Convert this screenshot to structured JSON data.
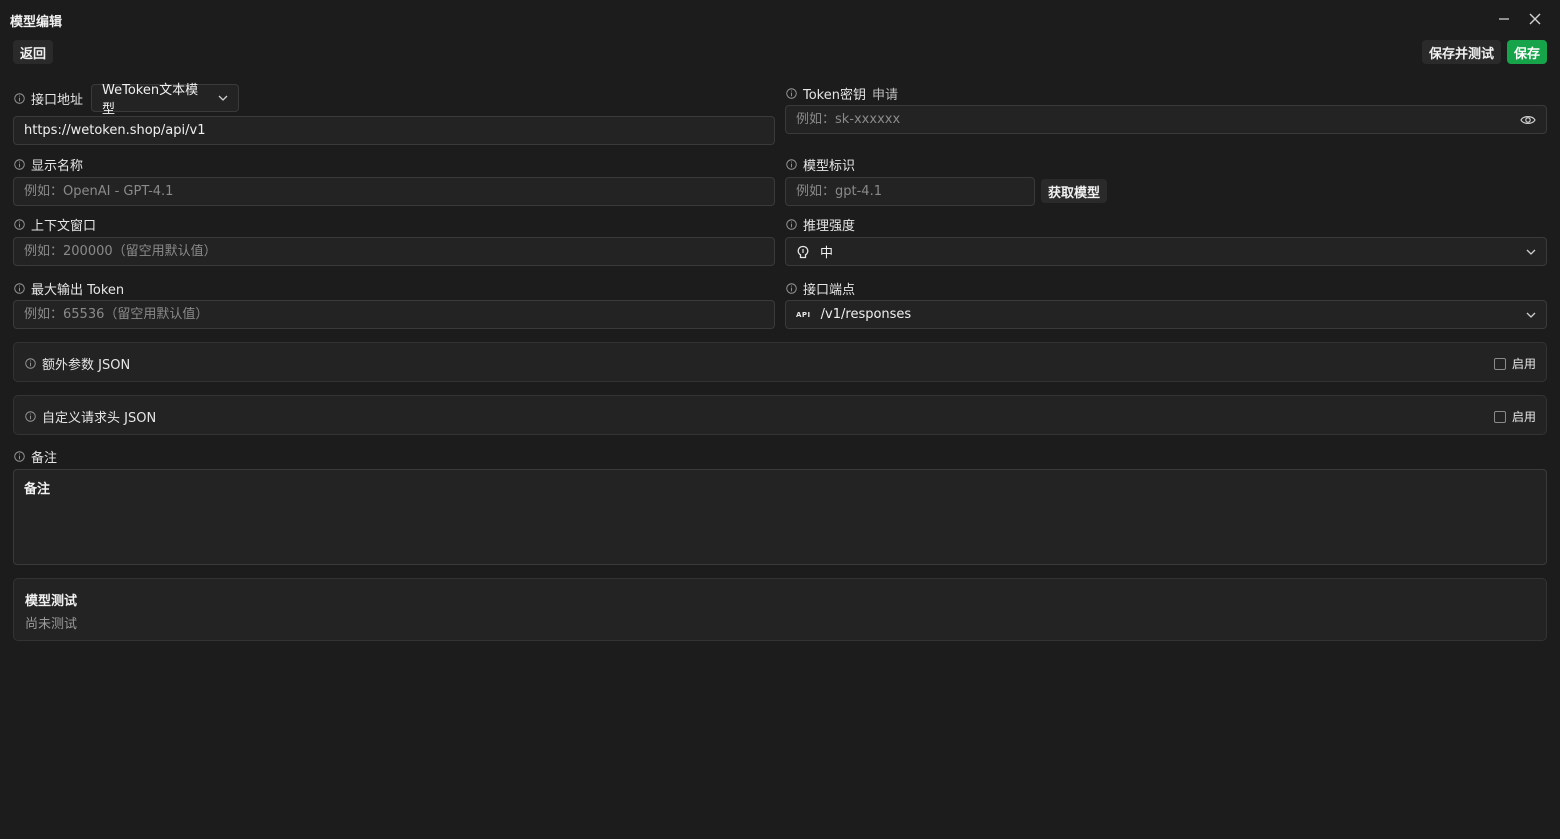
{
  "window": {
    "title": "模型编辑"
  },
  "toolbar": {
    "back_label": "返回",
    "save_test_label": "保存并测试",
    "save_label": "保存"
  },
  "form": {
    "api_address": {
      "label": "接口地址",
      "provider_select": "WeToken文本模型",
      "value": "https://wetoken.shop/api/v1"
    },
    "token": {
      "label": "Token密钥",
      "apply_link": "申请",
      "placeholder": "例如：sk-xxxxxx"
    },
    "display_name": {
      "label": "显示名称",
      "placeholder": "例如：OpenAI - GPT-4.1"
    },
    "model_id": {
      "label": "模型标识",
      "placeholder": "例如：gpt-4.1",
      "fetch_label": "获取模型"
    },
    "context_window": {
      "label": "上下文窗口",
      "placeholder": "例如：200000（留空用默认值）"
    },
    "reasoning": {
      "label": "推理强度",
      "value": "中"
    },
    "max_output": {
      "label": "最大输出 Token",
      "placeholder": "例如：65536（留空用默认值）"
    },
    "endpoint": {
      "label": "接口端点",
      "icon_text": "API",
      "value": "/v1/responses"
    },
    "extra_params": {
      "label": "额外参数 JSON",
      "enable_label": "启用"
    },
    "custom_headers": {
      "label": "自定义请求头 JSON",
      "enable_label": "启用"
    },
    "notes": {
      "label": "备注",
      "placeholder": "备注"
    }
  },
  "test": {
    "title": "模型测试",
    "status": "尚未测试"
  },
  "colors": {
    "background": "#1c1c1c",
    "accent_green": "#16a34a",
    "field_bg": "#232323",
    "border": "#3a3a3a"
  }
}
